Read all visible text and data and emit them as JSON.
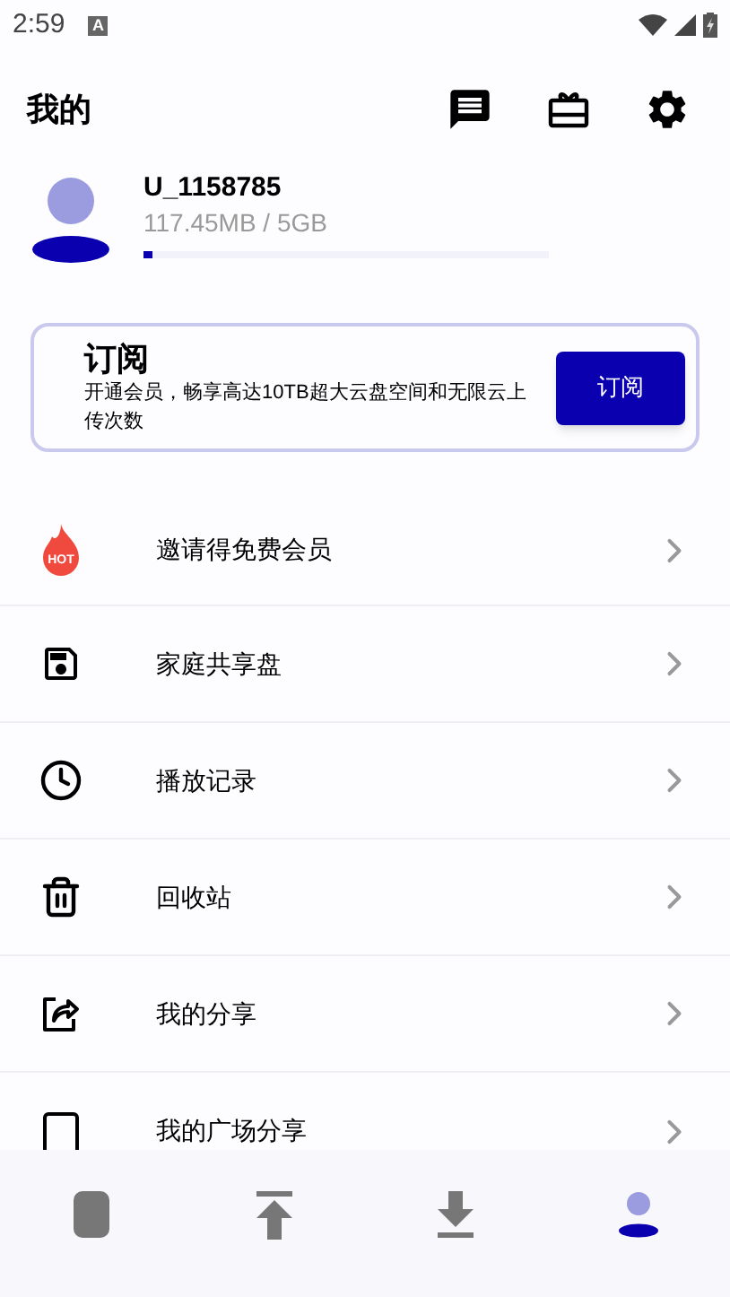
{
  "status_bar": {
    "time": "2:59",
    "badge": "A"
  },
  "header": {
    "title": "我的"
  },
  "profile": {
    "username": "U_1158785",
    "storage": "117.45MB / 5GB",
    "level": 0.02
  },
  "subscribe_card": {
    "title": "订阅",
    "description": "开通会员，畅享高达10TB超大云盘空间和无限云上传次数",
    "button": "订阅"
  },
  "menu": [
    {
      "kind": "hot",
      "label": "邀请得免费会员",
      "icon_text": "HOT"
    },
    {
      "kind": "disk",
      "label": "家庭共享盘"
    },
    {
      "kind": "history",
      "label": "播放记录"
    },
    {
      "kind": "trash",
      "label": "回收站"
    },
    {
      "kind": "share",
      "label": "我的分享"
    },
    {
      "kind": "square",
      "label": "我的广场分享"
    }
  ],
  "bottom_nav": [
    {
      "kind": "files",
      "selected": false
    },
    {
      "kind": "upload",
      "selected": false
    },
    {
      "kind": "download",
      "selected": false
    },
    {
      "kind": "profile",
      "selected": true
    }
  ]
}
